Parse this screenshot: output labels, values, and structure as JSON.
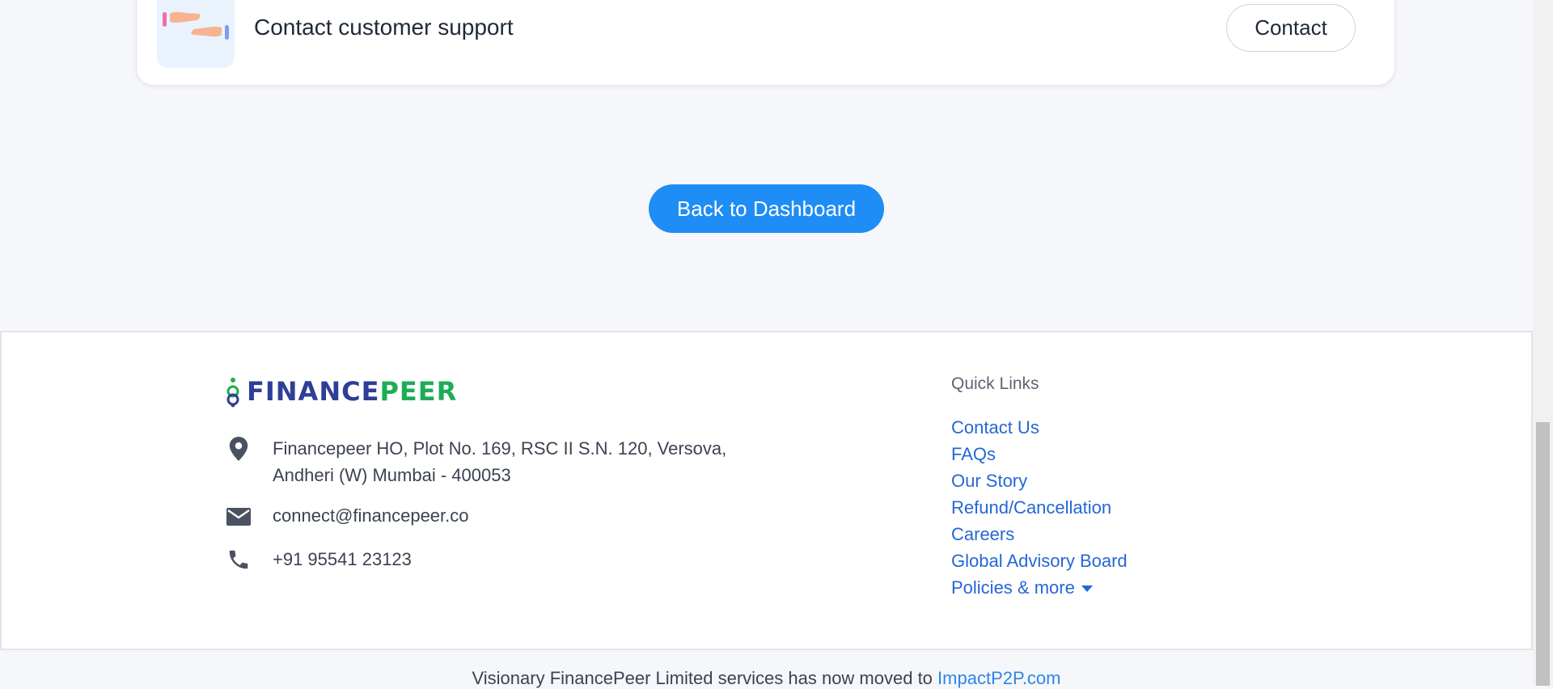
{
  "support": {
    "title": "Contact customer support",
    "contact_label": "Contact"
  },
  "dashboard": {
    "button_label": "Back to Dashboard"
  },
  "footer": {
    "brand": {
      "name_part1": "FINANCE",
      "name_part2": "PEER",
      "color_part1": "#2f3e96",
      "color_part2": "#1fac56"
    },
    "address_line1": "Financepeer HO, Plot No. 169, RSC II S.N. 120, Versova,",
    "address_line2": "Andheri (W) Mumbai - 400053",
    "email": "connect@financepeer.co",
    "phone": "+91 95541 23123",
    "quick_links": {
      "title": "Quick Links",
      "items": [
        {
          "label": "Contact Us"
        },
        {
          "label": "FAQs"
        },
        {
          "label": "Our Story"
        },
        {
          "label": "Refund/Cancellation"
        },
        {
          "label": "Careers"
        },
        {
          "label": "Global Advisory Board"
        },
        {
          "label": "Policies & more"
        }
      ]
    }
  },
  "notice": {
    "text": "Visionary FinancePeer Limited services has now moved to ",
    "link": "ImpactP2P.com"
  },
  "icons": {
    "support": "handshake-support-icon",
    "address": "location-pin-icon",
    "email": "mail-icon",
    "phone": "phone-icon",
    "policies": "caret-down-icon"
  },
  "colors": {
    "accent": "#1e8df5",
    "link": "#2467d6",
    "page_bg": "#f6f7fb"
  }
}
